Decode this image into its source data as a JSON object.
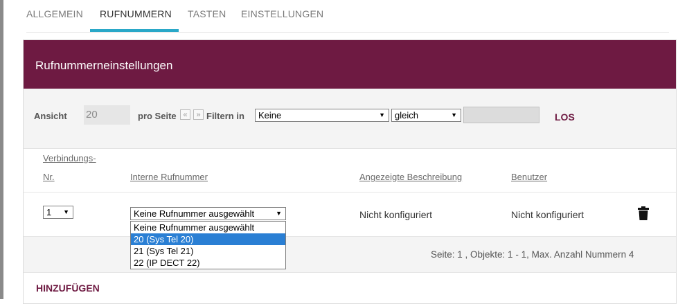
{
  "tabs": [
    {
      "label": "ALLGEMEIN"
    },
    {
      "label": "RUFNUMMERN"
    },
    {
      "label": "TASTEN"
    },
    {
      "label": "EINSTELLUNGEN"
    }
  ],
  "panel": {
    "title": "Rufnummerneinstellungen"
  },
  "filter": {
    "view_label": "Ansicht",
    "view_value": "20",
    "per_page_label": "pro Seite",
    "prev_icon": "«",
    "next_icon": "»",
    "filter_in_label": "Filtern in",
    "field_value": "Keine",
    "operator_value": "gleich",
    "go_label": "LOS"
  },
  "table": {
    "headers": {
      "nr_line1": "Verbindungs-",
      "nr_line2": "Nr.",
      "internal": "Interne Rufnummer",
      "description": "Angezeigte Beschreibung",
      "user": "Benutzer"
    },
    "row": {
      "nr_value": "1",
      "internal_value": "Keine Rufnummer ausgewählt",
      "description": "Nicht konfiguriert",
      "user": "Nicht konfiguriert"
    },
    "dropdown_options": [
      "Keine Rufnummer ausgewählt",
      "20 (Sys Tel 20)",
      "21 (Sys Tel 21)",
      "22 (IP DECT 22)"
    ],
    "dropdown_highlighted": "20 (Sys Tel 20)"
  },
  "paging": "Seite: 1 , Objekte: 1 - 1, Max. Anzahl Nummern 4",
  "add_label": "HINZUFÜGEN",
  "colors": {
    "accent": "#6e1a42",
    "tab_active": "#2aa8c8",
    "selection": "#2a7fd4"
  },
  "icons": {
    "delete": "trash-icon",
    "dropdown": "chevron-down-icon"
  }
}
